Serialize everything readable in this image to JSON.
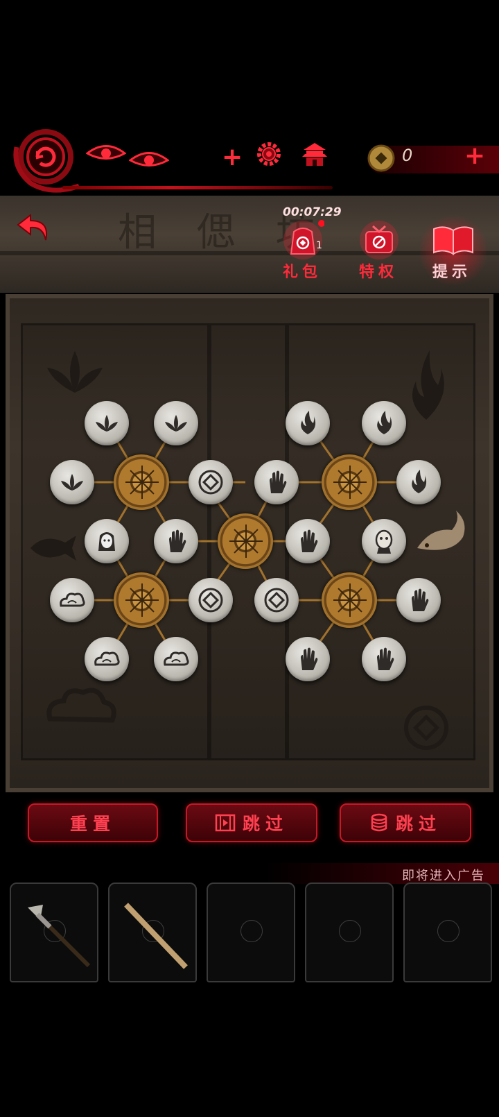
{
  "hud": {
    "coins": "0",
    "plus_1": "+",
    "plus_2": "+"
  },
  "header": {
    "board_title": "相 偲 坊",
    "timer": "00:07:29",
    "gift_label": "礼包",
    "gift_count": "1",
    "privilege_label": "特权",
    "hint_label": "提示"
  },
  "actions": {
    "reset_label": "重置",
    "skip_video_label": "跳过",
    "skip_coin_label": "跳过",
    "ad_notice": "即将进入广告"
  },
  "board": {
    "stones": [
      {
        "icon": "lotus-icon"
      },
      {
        "icon": "lotus-icon"
      },
      {
        "icon": "flame-icon"
      },
      {
        "icon": "flame-icon"
      },
      {
        "icon": "lotus-icon"
      },
      {
        "icon": "coin-icon"
      },
      {
        "icon": "hand-icon"
      },
      {
        "icon": "flame-icon"
      },
      {
        "icon": "girl-face-icon"
      },
      {
        "icon": "hand-icon"
      },
      {
        "icon": "hand-icon"
      },
      {
        "icon": "bald-face-icon"
      },
      {
        "icon": "cloud-icon"
      },
      {
        "icon": "coin-icon"
      },
      {
        "icon": "coin-icon"
      },
      {
        "icon": "hand-icon"
      },
      {
        "icon": "cloud-icon"
      },
      {
        "icon": "cloud-icon"
      },
      {
        "icon": "hand-icon"
      },
      {
        "icon": "hand-icon"
      }
    ]
  },
  "inventory": {
    "items": [
      {
        "icon": "suona-horn-icon"
      },
      {
        "icon": "wooden-stick-icon"
      },
      {
        "icon": "empty-slot-icon"
      },
      {
        "icon": "empty-slot-icon"
      },
      {
        "icon": "empty-slot-icon"
      }
    ]
  },
  "colors": {
    "accent_red": "#ff2a3a",
    "wood": "#3d342b",
    "stone": "#c9c6bf",
    "gold": "#b07a2e"
  }
}
